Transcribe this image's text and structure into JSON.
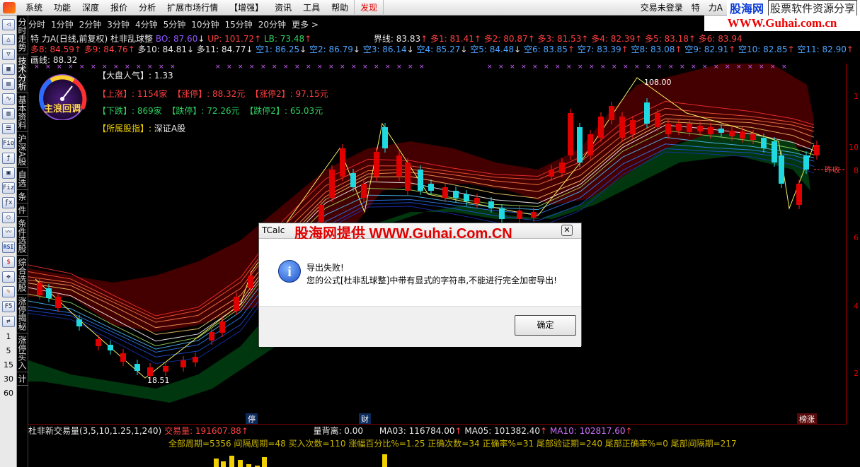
{
  "menu": {
    "items": [
      "系统",
      "功能",
      "深度",
      "报价",
      "分析",
      "扩展市场行情",
      "【增强】",
      "资讯",
      "工具",
      "帮助"
    ],
    "highlight": "发现",
    "right_items": [
      "交易未登录",
      "特",
      "力A"
    ]
  },
  "brand": {
    "name": "股海网",
    "slogan": "股票软件资源分享",
    "url": "WWW.Guhai.com.cn"
  },
  "left_toolbar": {
    "numbers": [
      "1",
      "5",
      "15",
      "30",
      "60"
    ]
  },
  "vertical_tabs": [
    "分时走势",
    "技术分析",
    "基本资料",
    "沪深A股",
    "自选",
    "条",
    "件",
    "条件选股",
    "综合选股",
    "涨停揭秘",
    "涨停买入",
    "计"
  ],
  "timeframes": [
    "分时",
    "1分钟",
    "2分钟",
    "3分钟",
    "4分钟",
    "5分钟",
    "10分钟",
    "15分钟",
    "20分钟",
    "更多 >"
  ],
  "indicator": {
    "stock": "特 力A(日线,前复权) 杜非乱球整",
    "bo": "BO: 87.60",
    "up": "UP: 101.72",
    "lb": "LB: 73.48",
    "jx": "界线: 83.83",
    "duo": [
      "多1: 81.41",
      "多2: 80.87",
      "多3: 81.53",
      "多4: 82.39",
      "多5: 83.18",
      "多6: 83.94"
    ],
    "row2_duo": [
      "多8: 84.59",
      "多9: 84.76",
      "多10: 84.81",
      "多11: 84.77"
    ],
    "kong": [
      "空1: 86.25",
      "空2: 86.79",
      "空3: 86.14",
      "空4: 85.27",
      "空5: 84.48",
      "空6: 83.85",
      "空7: 83.39",
      "空8: 83.08",
      "空9: 82.91",
      "空10: 82.85",
      "空11: 82.90"
    ],
    "hx": "画线: 88.32"
  },
  "market_info": {
    "dp_label": "【大盘人气】:",
    "dp_value": "1.33",
    "up_label": "【上涨】:",
    "up_value": "1154家",
    "zt_label": "【涨停】:",
    "zt_value": "88.32元",
    "zt2_label": "【涨停2】:",
    "zt2_value": "97.15元",
    "down_label": "【下跌】:",
    "down_value": "869家",
    "dt_label": "【跌停】:",
    "dt_value": "72.26元",
    "dt2_label": "【跌停2】:",
    "dt2_value": "65.03元",
    "idx_label": "【所属股指】:",
    "idx_value": "深证A股"
  },
  "gauge": {
    "label": "主浪回调"
  },
  "annotations": {
    "high": "108.00",
    "low": "18.51",
    "yesterday": "昨收"
  },
  "axis_ticks": [
    "1",
    "10",
    "8",
    "6",
    "4",
    "2"
  ],
  "xmarks": [
    "停",
    "财",
    "榜涨"
  ],
  "volume": {
    "title": "杜非新交易量(3,5,10,1.25,1,240)",
    "vol": "交易量: 191607.88",
    "bl": "量背离: 0.00",
    "ma03": "MA03: 116784.00",
    "ma05": "MA05: 101382.40",
    "ma10": "MA10: 102817.60",
    "stats": "全部周期=5356  间隔周期=48  买入次数=110  涨幅百分比%=1.25  正确次数=34  正确率%=31  尾部验证期=240  尾部正确率%=0  尾部间隔期=217"
  },
  "dialog": {
    "title": "TCalc",
    "watermark": "股海网提供 WWW.Guhai.Com.CN",
    "msg1": "导出失败!",
    "msg2": "您的公式[杜非乱球整]中带有显式的字符串,不能进行完全加密导出!",
    "ok": "确定"
  }
}
